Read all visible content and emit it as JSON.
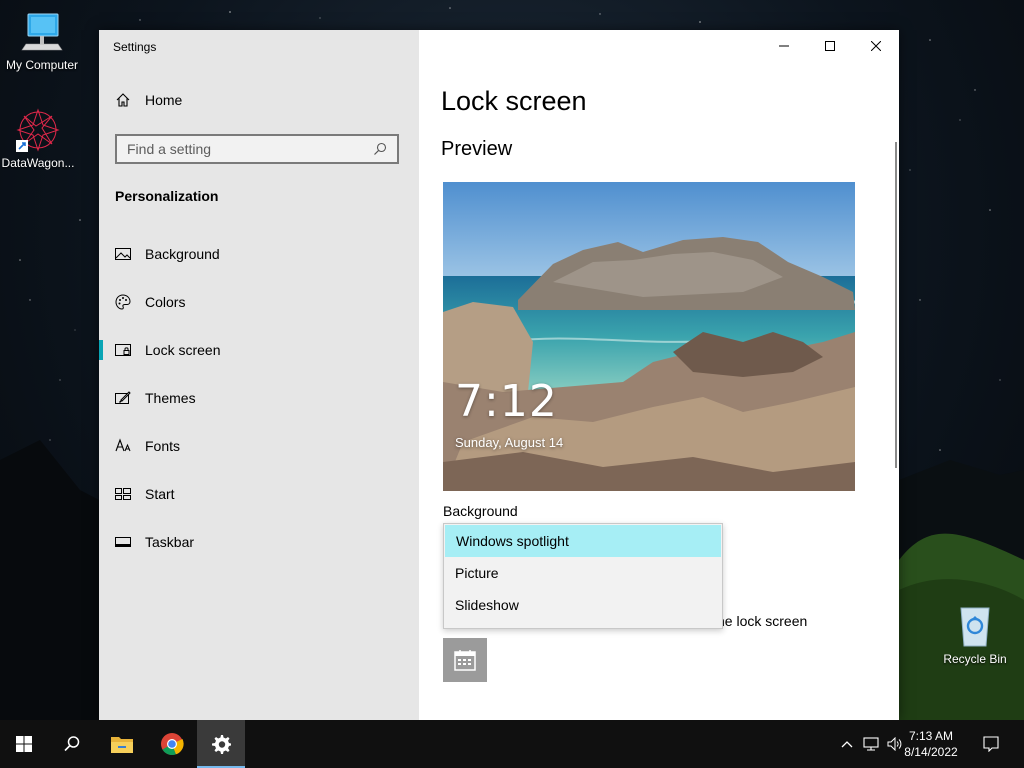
{
  "desktop": {
    "icons": [
      {
        "label": "My Computer"
      },
      {
        "label": "DataWagon..."
      },
      {
        "label": "Recycle Bin"
      }
    ]
  },
  "window": {
    "title": "Settings",
    "sidebar": {
      "home_label": "Home",
      "search_placeholder": "Find a setting",
      "section_title": "Personalization",
      "items": [
        {
          "label": "Background",
          "icon": "picture-icon"
        },
        {
          "label": "Colors",
          "icon": "palette-icon"
        },
        {
          "label": "Lock screen",
          "icon": "lock-screen-icon",
          "selected": true
        },
        {
          "label": "Themes",
          "icon": "brush-icon"
        },
        {
          "label": "Fonts",
          "icon": "font-icon"
        },
        {
          "label": "Start",
          "icon": "start-icon"
        },
        {
          "label": "Taskbar",
          "icon": "taskbar-icon"
        }
      ]
    },
    "content": {
      "page_title": "Lock screen",
      "preview_heading": "Preview",
      "preview_time": "7:12",
      "preview_date": "Sunday, August 14",
      "background_label": "Background",
      "dropdown_options": [
        "Windows spotlight",
        "Picture",
        "Slideshow"
      ],
      "dropdown_selected": "Windows spotlight",
      "partial_text": "he lock screen"
    }
  },
  "taskbar": {
    "clock_time": "7:13 AM",
    "clock_date": "8/14/2022"
  },
  "colors": {
    "accent": "#0aa5b5",
    "selected_option": "#a6eef5",
    "taskbar": "#101010",
    "sidebar": "#e6e6e6"
  }
}
